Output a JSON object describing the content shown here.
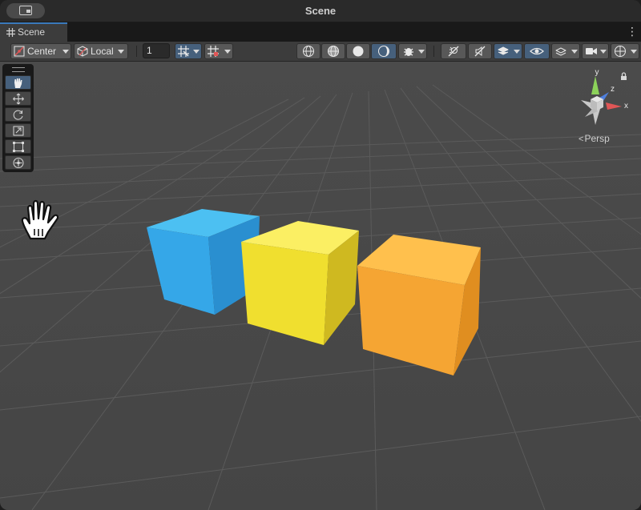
{
  "window": {
    "title": "Scene",
    "tab_label": "Scene",
    "more_menu_glyph": "⋮"
  },
  "toolbar": {
    "pivot_position": "Center",
    "pivot_rotation": "Local",
    "grid_size": "1",
    "draw_mode_selected": "shaded",
    "lighting_on": true,
    "visibility_on": true
  },
  "tools": {
    "selected": "view-tool",
    "items": [
      "view-tool",
      "move-tool",
      "rotate-tool",
      "scale-tool",
      "rect-tool",
      "transform-tool"
    ]
  },
  "gizmo": {
    "axis_x": "x",
    "axis_y": "y",
    "axis_z": "z",
    "projection": "Persp",
    "projection_icon": "<"
  },
  "scene": {
    "objects": [
      {
        "name": "blue-cube",
        "color": "#2ea6e6"
      },
      {
        "name": "yellow-cube",
        "color": "#f2e02a"
      },
      {
        "name": "orange-cube",
        "color": "#f4a12e"
      }
    ],
    "background": "#4a4a4a",
    "grid_color": "#5a5a5a"
  },
  "colors": {
    "accent_active": "#46607c",
    "tab_underline": "#3a79bb",
    "axis_x": "#e05656",
    "axis_y": "#8cd25a",
    "axis_z": "#4f7fdd"
  }
}
